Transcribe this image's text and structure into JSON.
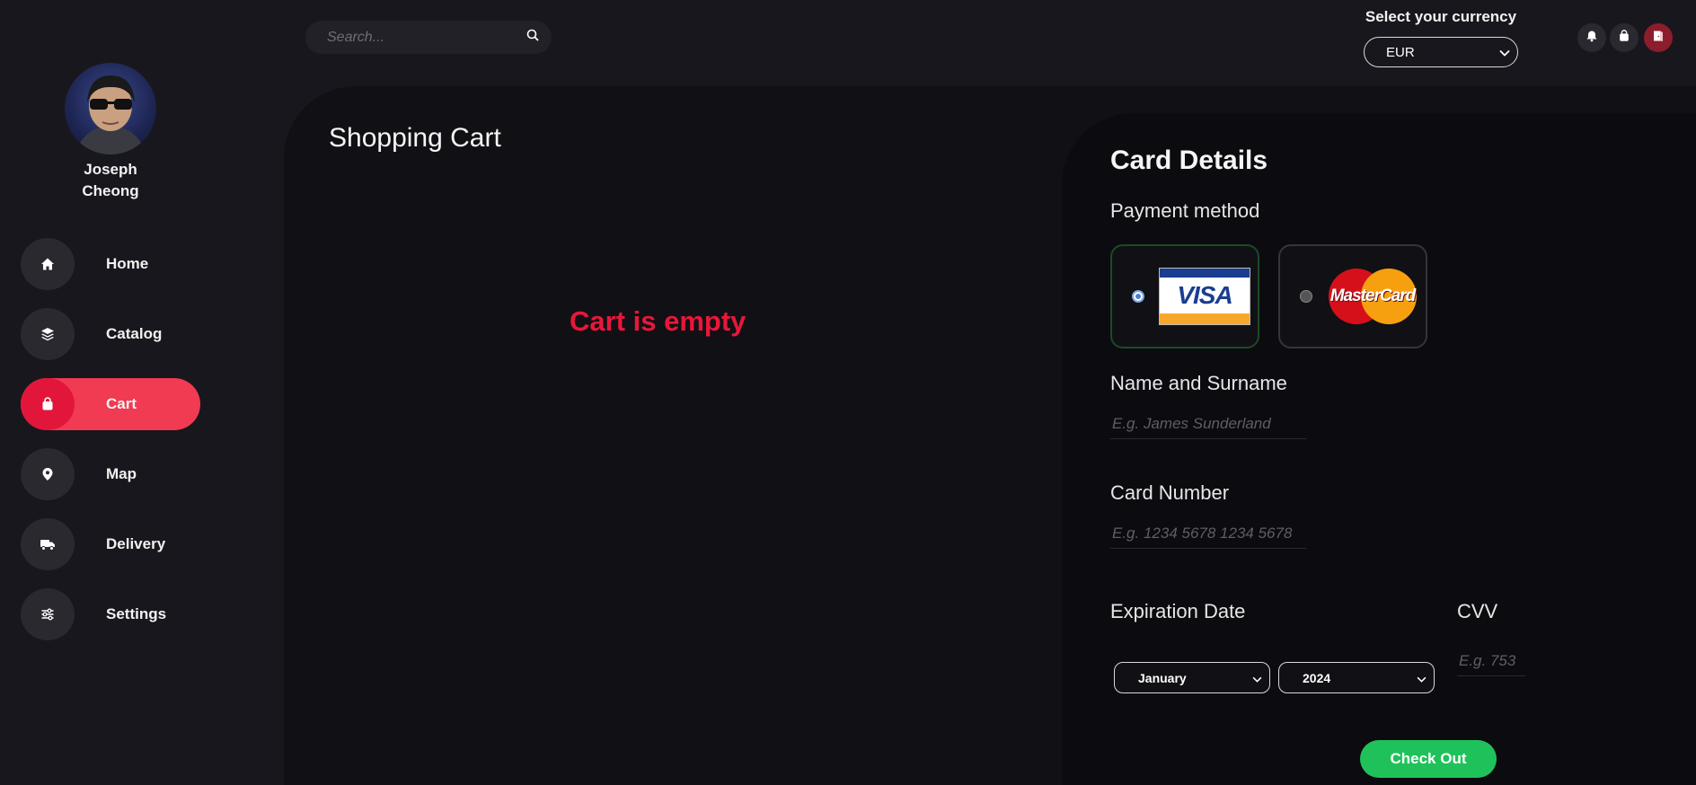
{
  "user": {
    "name": "Joseph Cheong"
  },
  "nav": {
    "items": [
      {
        "label": "Home",
        "icon": "home-icon"
      },
      {
        "label": "Catalog",
        "icon": "layers-icon"
      },
      {
        "label": "Cart",
        "icon": "shopping-bag-icon",
        "active": true
      },
      {
        "label": "Map",
        "icon": "map-pin-icon"
      },
      {
        "label": "Delivery",
        "icon": "truck-icon"
      },
      {
        "label": "Settings",
        "icon": "sliders-icon"
      }
    ]
  },
  "search": {
    "placeholder": "Search..."
  },
  "currency": {
    "label": "Select your currency",
    "value": "EUR"
  },
  "cart": {
    "title": "Shopping Cart",
    "empty_message": "Cart is empty"
  },
  "card": {
    "title": "Card Details",
    "payment_method_label": "Payment method",
    "methods": [
      {
        "name": "VISA",
        "selected": true
      },
      {
        "name": "MasterCard",
        "selected": false
      }
    ],
    "name_label": "Name and Surname",
    "name_placeholder": "E.g. James Sunderland",
    "number_label": "Card Number",
    "number_placeholder": "E.g. 1234 5678 1234 5678",
    "expiration_label": "Expiration Date",
    "month_value": "January",
    "year_value": "2024",
    "cvv_label": "CVV",
    "cvv_placeholder": "E.g. 753",
    "checkout_label": "Check Out"
  },
  "colors": {
    "accent": "#f03b52",
    "accent_dark": "#e2163a",
    "error_text": "#e8173a",
    "checkout_green": "#1fc25a",
    "background": "#18171d",
    "panel": "#111015"
  }
}
